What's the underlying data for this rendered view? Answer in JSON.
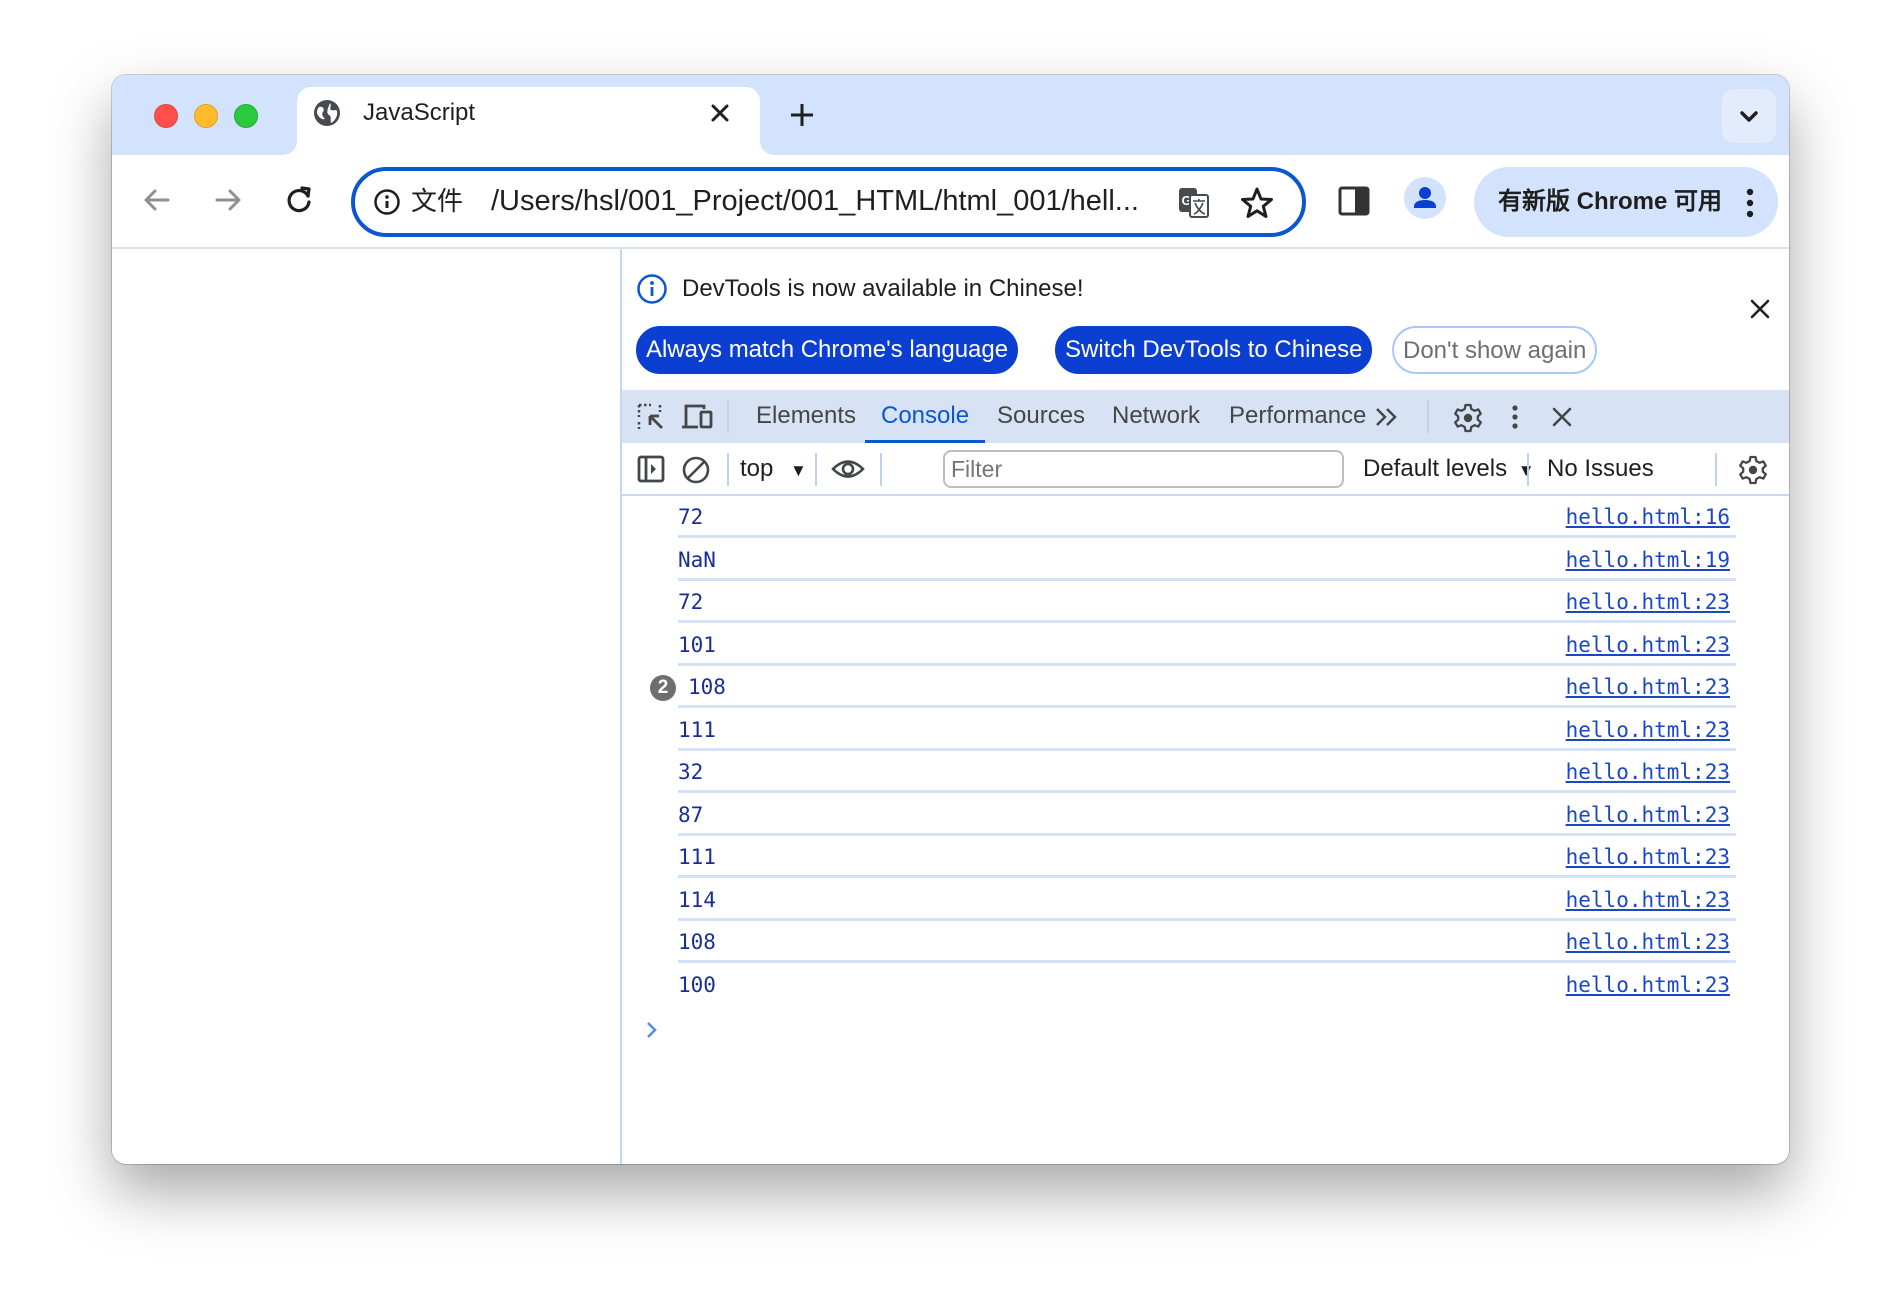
{
  "browser": {
    "tab": {
      "title": "JavaScript",
      "favicon": "globe-icon",
      "close_icon": "×"
    },
    "new_tab_icon": "+",
    "tab_search_icon": "chevron-down-icon",
    "omnibox": {
      "security_icon": "info-icon",
      "scheme_label": "文件",
      "url": "/Users/hsl/001_Project/001_HTML/html_001/hell...",
      "translate_icon": "translate-icon",
      "bookmark_icon": "star-icon"
    },
    "update_chip": {
      "label": "有新版 Chrome 可用"
    }
  },
  "devtools": {
    "infobar": {
      "message": "DevTools is now available in Chinese!",
      "buttons": [
        {
          "label": "Always match Chrome's language",
          "style": "primary"
        },
        {
          "label": "Switch DevTools to Chinese",
          "style": "primary"
        },
        {
          "label": "Don't show again",
          "style": "outline"
        }
      ]
    },
    "tabs": [
      {
        "label": "Elements",
        "active": false
      },
      {
        "label": "Console",
        "active": true
      },
      {
        "label": "Sources",
        "active": false
      },
      {
        "label": "Network",
        "active": false
      },
      {
        "label": "Performance",
        "active": false
      }
    ],
    "more_tabs_icon": "»",
    "console_toolbar": {
      "context": "top",
      "filter_placeholder": "Filter",
      "filter_value": "",
      "levels": "Default levels",
      "issues": "No Issues"
    },
    "console_messages": [
      {
        "value": "72",
        "source": "hello.html:16",
        "count": null
      },
      {
        "value": "NaN",
        "source": "hello.html:19",
        "count": null
      },
      {
        "value": "72",
        "source": "hello.html:23",
        "count": null
      },
      {
        "value": "101",
        "source": "hello.html:23",
        "count": null
      },
      {
        "value": "108",
        "source": "hello.html:23",
        "count": "2"
      },
      {
        "value": "111",
        "source": "hello.html:23",
        "count": null
      },
      {
        "value": "32",
        "source": "hello.html:23",
        "count": null
      },
      {
        "value": "87",
        "source": "hello.html:23",
        "count": null
      },
      {
        "value": "111",
        "source": "hello.html:23",
        "count": null
      },
      {
        "value": "114",
        "source": "hello.html:23",
        "count": null
      },
      {
        "value": "108",
        "source": "hello.html:23",
        "count": null
      },
      {
        "value": "100",
        "source": "hello.html:23",
        "count": null
      }
    ]
  },
  "colors": {
    "accent": "#0b57d0",
    "tabstrip": "#d3e3fd",
    "console_value": "#1a2f96",
    "console_link": "#1a47c6"
  }
}
